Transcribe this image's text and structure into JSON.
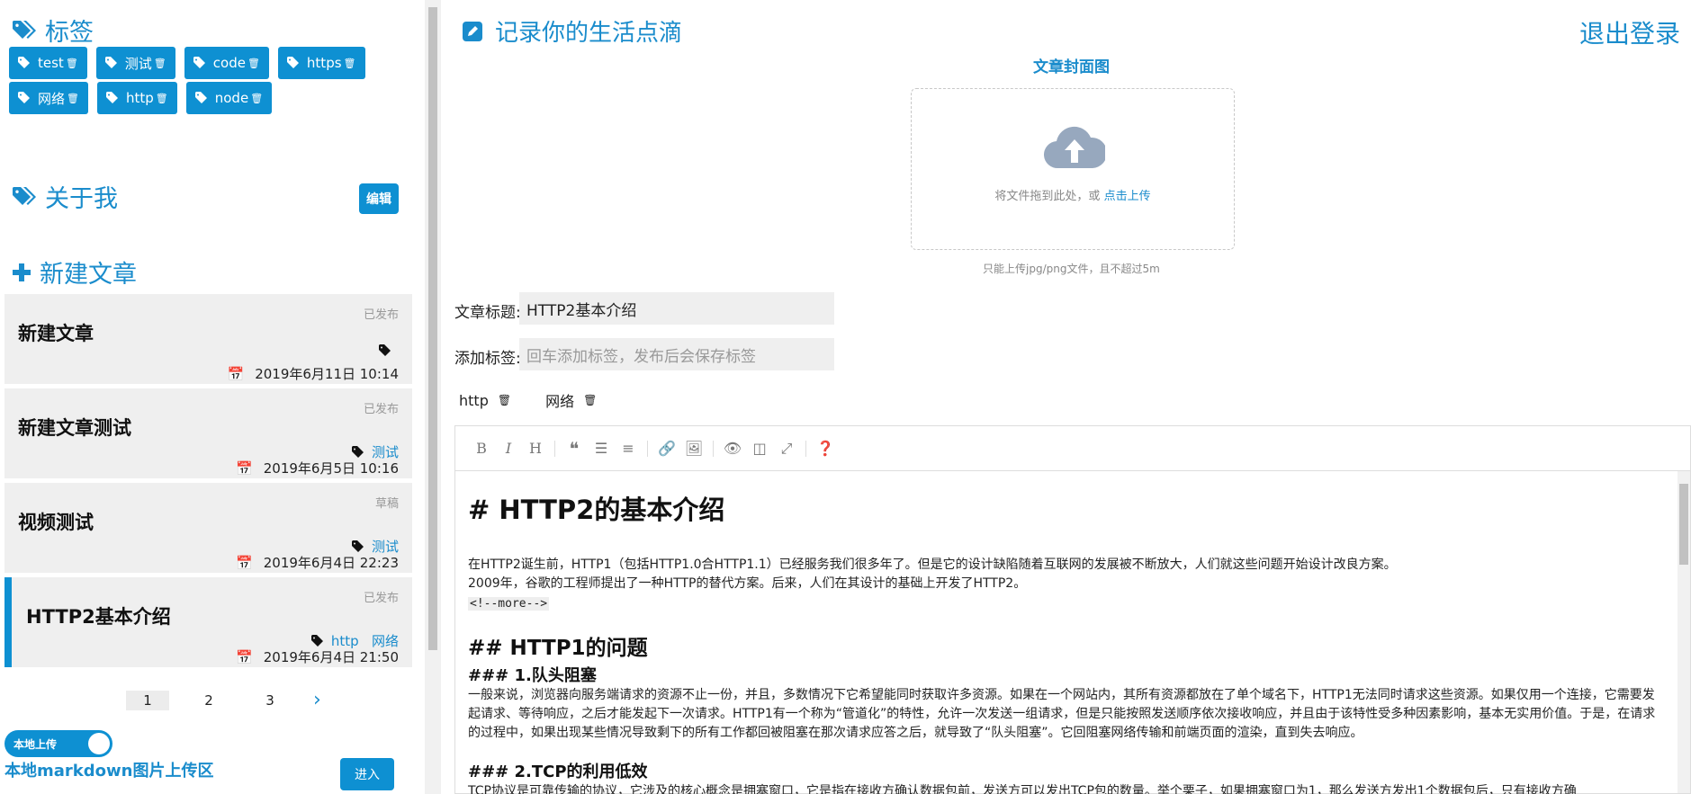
{
  "sidebar": {
    "tags_title": "标签",
    "tags": [
      {
        "label": "test"
      },
      {
        "label": "测试"
      },
      {
        "label": "code"
      },
      {
        "label": "https"
      },
      {
        "label": "网络"
      },
      {
        "label": "http"
      },
      {
        "label": "node"
      }
    ],
    "about_title": "关于我",
    "edit_label": "编辑",
    "new_post_title": "新建文章",
    "posts": [
      {
        "title": "新建文章",
        "status": "已发布",
        "tags": "",
        "date": "2019年6月11日 10:14"
      },
      {
        "title": "新建文章测试",
        "status": "已发布",
        "tags": "测试",
        "date": "2019年6月5日 10:16"
      },
      {
        "title": "视频测试",
        "status": "草稿",
        "tags": "测试",
        "date": "2019年6月4日 22:23"
      },
      {
        "title": "HTTP2基本介绍",
        "status": "已发布",
        "tags": "http   网络",
        "date": "2019年6月4日 21:50"
      }
    ],
    "pagination": {
      "pages": [
        "1",
        "2",
        "3"
      ],
      "current": "1",
      "next": "›"
    },
    "toggle_label": "本地上传",
    "upload_area_label": "本地markdown图片上传区",
    "enter_label": "进入"
  },
  "main": {
    "header_title": "记录你的生活点滴",
    "logout_label": "退出登录",
    "cover_label": "文章封面图",
    "dropzone_text": "将文件拖到此处，或",
    "dropzone_link": "点击上传",
    "upload_hint": "只能上传jpg/png文件，且不超过5m",
    "title_label": "文章标题:",
    "title_value": "HTTP2基本介绍",
    "tags_label": "添加标签:",
    "tags_placeholder": "回车添加标签，发布后会保存标签",
    "chosen_tags": [
      {
        "label": "http"
      },
      {
        "label": "网络"
      }
    ],
    "editor": {
      "h1": "# HTTP2的基本介绍",
      "p1": "在HTTP2诞生前，HTTP1（包括HTTP1.0合HTTP1.1）已经服务我们很多年了。但是它的设计缺陷随着互联网的发展被不断放大，人们就这些问题开始设计改良方案。",
      "p2": "2009年，谷歌的工程师提出了一种HTTP的替代方案。后来，人们在其设计的基础上开发了HTTP2。",
      "more": "<!--more-->",
      "h2": "## HTTP1的问题",
      "h3a": "### 1.队头阻塞",
      "p3": "一般来说，浏览器向服务端请求的资源不止一份，并且，多数情况下它希望能同时获取许多资源。如果在一个网站内，其所有资源都放在了单个域名下，HTTP1无法同时请求这些资源。如果仅用一个连接，它需要发起请求、等待响应，之后才能发起下一次请求。HTTP1有一个称为“管道化”的特性，允许一次发送一组请求，但是只能按照发送顺序依次接收响应，并且由于该特性受多种因素影响，基本无实用价值。于是，在请求的过程中，如果出现某些情况导致剩下的所有工作都回被阻塞在那次请求应答之后，就导致了“队头阻塞”。它回阻塞网络传输和前端页面的渲染，直到失去响应。",
      "h3b": "### 2.TCP的利用低效",
      "p4": "TCP协议是可靠传输的协议，它涉及的核心概念是拥塞窗口，它是指在接收方确认数据包前，发送方可以发出TCP包的数量。举个栗子，如果拥塞窗口为1，那么发送方发出1个数据包后，只有接收方确"
    }
  }
}
